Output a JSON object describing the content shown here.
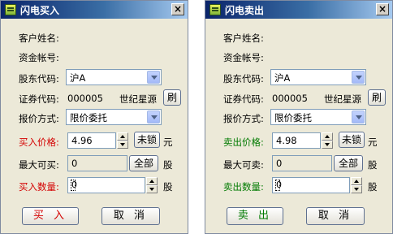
{
  "buy": {
    "title": "闪电买入",
    "close": "×",
    "customer_label": "客户姓名:",
    "account_label": "资金帐号:",
    "holder_label": "股东代码:",
    "holder_value": "沪A",
    "code_label": "证券代码:",
    "code_value": "000005",
    "stock_name": "世纪星源",
    "refresh": "刷",
    "quote_label": "报价方式:",
    "quote_value": "限价委托",
    "price_label": "买入价格:",
    "price_value": "4.96",
    "lock": "未锁",
    "price_unit": "元",
    "max_label": "最大可买:",
    "max_value": "0",
    "all": "全部",
    "max_unit": "股",
    "qty_label": "买入数量:",
    "qty_value": "0",
    "qty_unit": "股",
    "action": "买 入",
    "cancel": "取 消"
  },
  "sell": {
    "title": "闪电卖出",
    "close": "×",
    "customer_label": "客户姓名:",
    "account_label": "资金帐号:",
    "holder_label": "股东代码:",
    "holder_value": "沪A",
    "code_label": "证券代码:",
    "code_value": "000005",
    "stock_name": "世纪星源",
    "refresh": "刷",
    "quote_label": "报价方式:",
    "quote_value": "限价委托",
    "price_label": "卖出价格:",
    "price_value": "4.98",
    "lock": "未锁",
    "price_unit": "元",
    "max_label": "最大可卖:",
    "max_value": "0",
    "all": "全部",
    "max_unit": "股",
    "qty_label": "卖出数量:",
    "qty_value": "0",
    "qty_unit": "股",
    "action": "卖 出",
    "cancel": "取 消"
  },
  "colors": {
    "buy_accent": "#d40000",
    "sell_accent": "#007a00"
  }
}
